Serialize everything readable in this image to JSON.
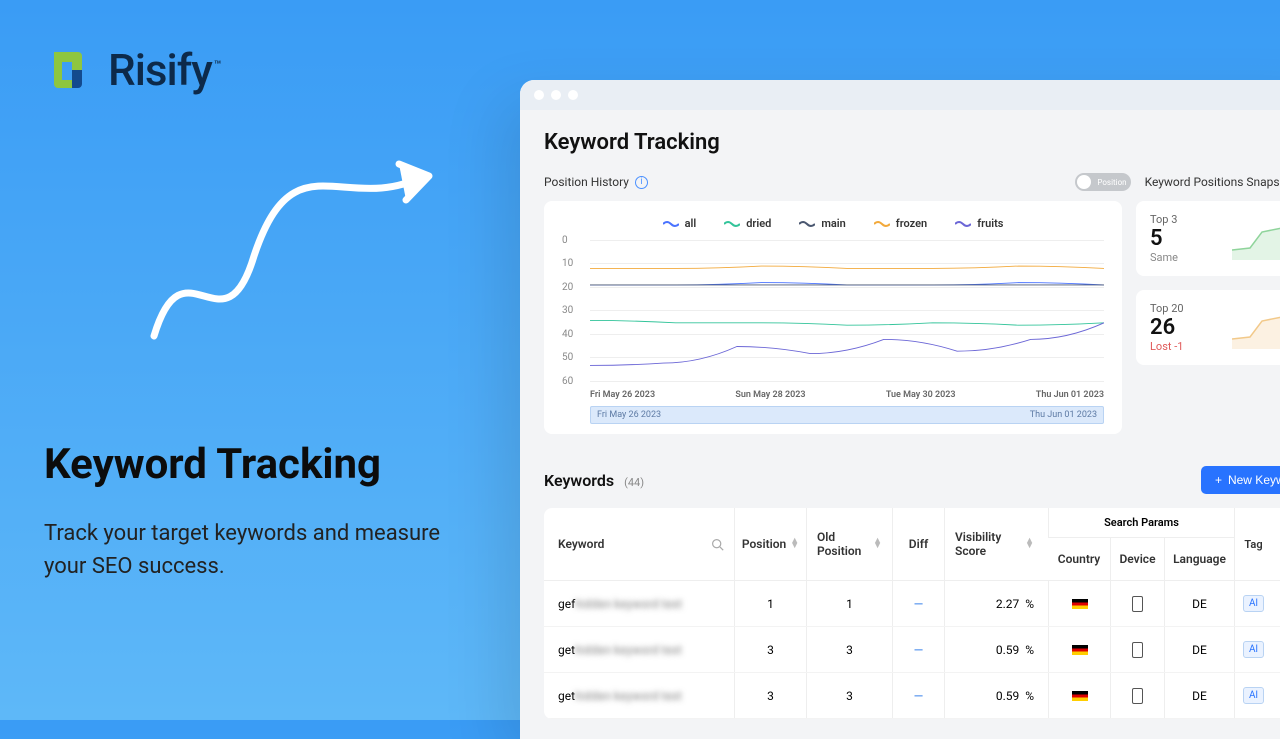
{
  "brand": {
    "name": "Risify",
    "tm": "™"
  },
  "promo": {
    "heading": "Keyword Tracking",
    "sub": "Track your target keywords and measure your SEO success."
  },
  "page": {
    "title": "Keyword Tracking"
  },
  "position_history": {
    "label": "Position History",
    "toggle": "Position",
    "snapshot_label": "Keyword Positions Snapshot"
  },
  "chart_data": {
    "type": "line",
    "title": "",
    "xlabel": "",
    "ylabel": "",
    "ylim": [
      0,
      60
    ],
    "y_ticks": [
      0,
      10,
      20,
      30,
      40,
      50,
      60
    ],
    "y_inverted": true,
    "categories": [
      "Fri May 26 2023",
      "Sun May 28 2023",
      "Tue May 30 2023",
      "Thu Jun 01 2023"
    ],
    "series": [
      {
        "name": "all",
        "color": "#4a73ff",
        "values": [
          19,
          19,
          18,
          19,
          19,
          18,
          19
        ]
      },
      {
        "name": "dried",
        "color": "#33c49a",
        "values": [
          34,
          35,
          35,
          36,
          35,
          36,
          35
        ]
      },
      {
        "name": "main",
        "color": "#4a5770",
        "values": [
          19,
          19,
          19,
          19,
          19,
          19,
          19
        ]
      },
      {
        "name": "frozen",
        "color": "#f2a93b",
        "values": [
          12,
          12,
          11,
          12,
          12,
          11,
          12
        ]
      },
      {
        "name": "fruits",
        "color": "#6b66d6",
        "values": [
          53,
          52,
          45,
          48,
          42,
          47,
          42,
          35
        ]
      }
    ],
    "range": {
      "start": "Fri May 26 2023",
      "end": "Thu Jun 01 2023"
    }
  },
  "snapshots": [
    {
      "label": "Top 3",
      "value": "5",
      "delta": "Same",
      "delta_neg": false,
      "color": "#8fd49b"
    },
    {
      "label": "Top 20",
      "value": "26",
      "delta": "Lost  -1",
      "delta_neg": true,
      "color": "#f2c98a"
    }
  ],
  "keywords_section": {
    "title": "Keywords",
    "count": "(44)",
    "new_button": "New Keyword",
    "columns": {
      "keyword": "Keyword",
      "position": "Position",
      "old_position": "Old Position",
      "diff": "Diff",
      "visibility": "Visibility Score",
      "search_params": "Search Params",
      "country": "Country",
      "device": "Device",
      "language": "Language",
      "tag": "Tag"
    },
    "rows": [
      {
        "keyword": "gef…",
        "position": "1",
        "old_position": "1",
        "diff": "—",
        "visibility": "2.27",
        "visibility_unit": "%",
        "country": "DE",
        "language": "DE",
        "tag": "Al"
      },
      {
        "keyword": "get…",
        "position": "3",
        "old_position": "3",
        "diff": "—",
        "visibility": "0.59",
        "visibility_unit": "%",
        "country": "DE",
        "language": "DE",
        "tag": "Al"
      },
      {
        "keyword": "get…",
        "position": "3",
        "old_position": "3",
        "diff": "—",
        "visibility": "0.59",
        "visibility_unit": "%",
        "country": "DE",
        "language": "DE",
        "tag": "Al"
      }
    ]
  }
}
